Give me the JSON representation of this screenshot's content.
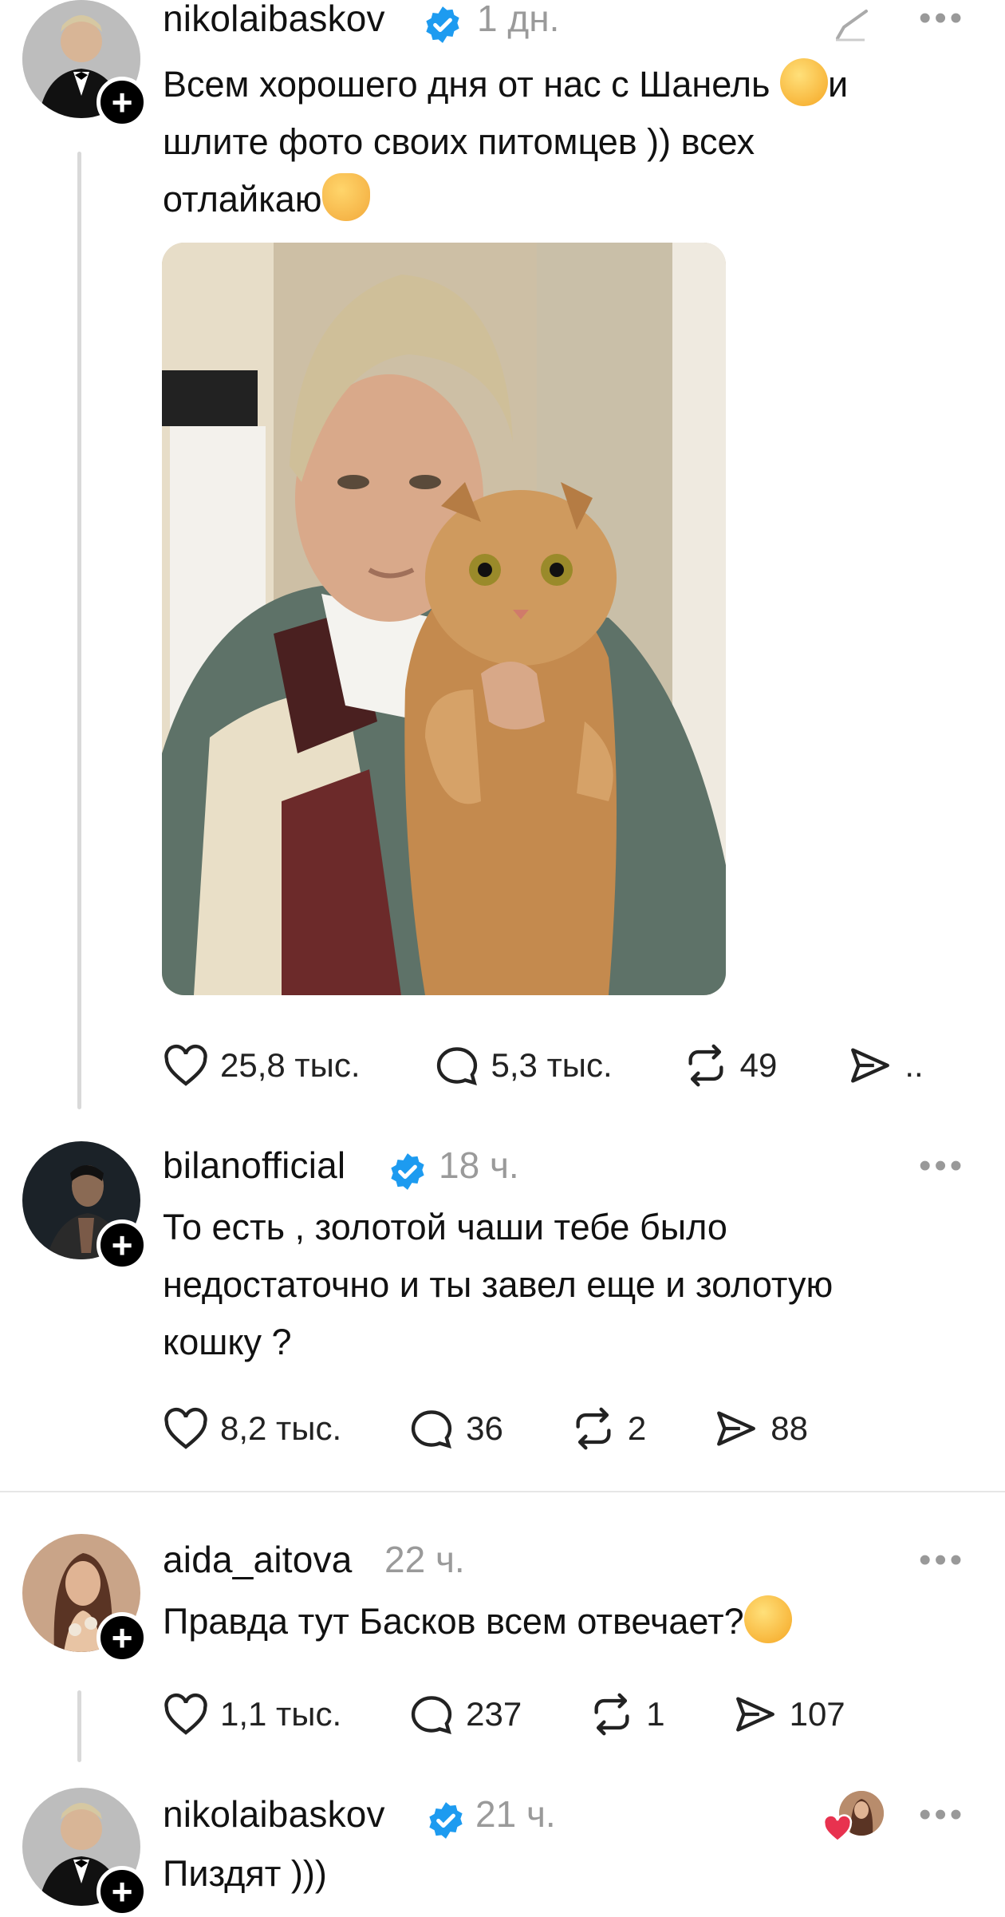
{
  "posts": [
    {
      "username": "nikolaibaskov",
      "time": "1 дн.",
      "text_lines": [
        "Всем хорошего дня от нас с Шанель ",
        "и",
        "шлите фото своих питомцев )) всех",
        "отлайкаю"
      ],
      "likes": "25,8 тыс.",
      "replies": "5,3 тыс.",
      "reposts": "49",
      "shares": ".."
    },
    {
      "username": "bilanofficial",
      "time": "18 ч.",
      "text_lines": [
        "То есть , золотой чаши тебе было",
        "недостаточно и ты завел еще и золотую",
        "кошку ?"
      ],
      "likes": "8,2 тыс.",
      "replies": "36",
      "reposts": "2",
      "shares": "88"
    },
    {
      "username": "aida_aitova",
      "time": "22 ч.",
      "text_lines": [
        "Правда тут Басков всем отвечает?"
      ],
      "likes": "1,1 тыс.",
      "replies": "237",
      "reposts": "1",
      "shares": "107"
    },
    {
      "username": "nikolaibaskov",
      "time": "21 ч.",
      "text_lines": [
        "Пиздят )))"
      ]
    }
  ],
  "colors": {
    "verified": "#1d9bf0",
    "muted": "#9a9a9a",
    "like_heart": "#e8324f"
  }
}
